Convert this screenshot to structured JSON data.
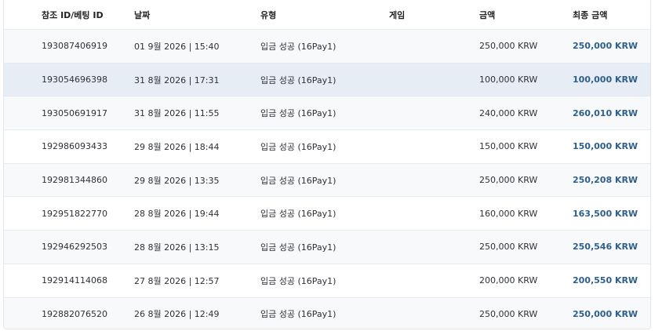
{
  "columns": {
    "id": "참조 ID/베팅 ID",
    "date": "날짜",
    "type": "유형",
    "game": "게임",
    "amount": "금액",
    "final": "최종 금액"
  },
  "rows": [
    {
      "id": "193087406919",
      "date": "01 9월 2026 | 15:40",
      "type": "입금 성공 (16Pay1)",
      "game": "",
      "amount": "250,000 KRW",
      "final": "250,000 KRW"
    },
    {
      "id": "193054696398",
      "date": "31 8월 2026 | 17:31",
      "type": "입금 성공 (16Pay1)",
      "game": "",
      "amount": "100,000 KRW",
      "final": "100,000 KRW"
    },
    {
      "id": "193050691917",
      "date": "31 8월 2026 | 11:55",
      "type": "입금 성공 (16Pay1)",
      "game": "",
      "amount": "240,000 KRW",
      "final": "260,010 KRW"
    },
    {
      "id": "192986093433",
      "date": "29 8월 2026 | 18:44",
      "type": "입금 성공 (16Pay1)",
      "game": "",
      "amount": "150,000 KRW",
      "final": "150,000 KRW"
    },
    {
      "id": "192981344860",
      "date": "29 8월 2026 | 13:35",
      "type": "입금 성공 (16Pay1)",
      "game": "",
      "amount": "250,000 KRW",
      "final": "250,208 KRW"
    },
    {
      "id": "192951822770",
      "date": "28 8월 2026 | 19:44",
      "type": "입금 성공 (16Pay1)",
      "game": "",
      "amount": "160,000 KRW",
      "final": "163,500 KRW"
    },
    {
      "id": "192946292503",
      "date": "28 8월 2026 | 13:15",
      "type": "입금 성공 (16Pay1)",
      "game": "",
      "amount": "250,000 KRW",
      "final": "250,546 KRW"
    },
    {
      "id": "192914114068",
      "date": "27 8월 2026 | 12:57",
      "type": "입금 성공 (16Pay1)",
      "game": "",
      "amount": "200,000 KRW",
      "final": "200,550 KRW"
    },
    {
      "id": "192882076520",
      "date": "26 8월 2026 | 12:49",
      "type": "입금 성공 (16Pay1)",
      "game": "",
      "amount": "250,000 KRW",
      "final": "250,000 KRW"
    }
  ],
  "colors": {
    "final_amount": "#2e5f8a",
    "row_alt": "#f8f9fa",
    "row_highlight": "#e6edf5"
  }
}
